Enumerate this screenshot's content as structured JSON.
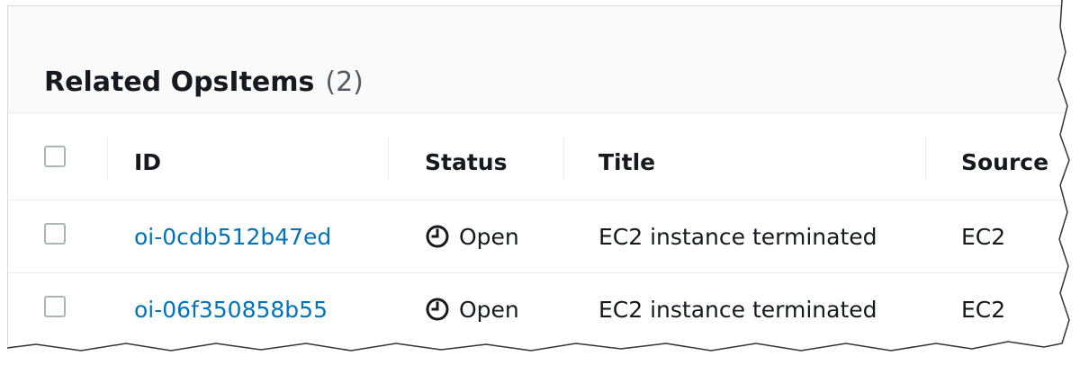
{
  "panel": {
    "title": "Related OpsItems",
    "count": "(2)"
  },
  "table": {
    "columns": [
      "ID",
      "Status",
      "Title",
      "Source"
    ],
    "rows": [
      {
        "id": "oi-0cdb512b47ed",
        "status": "Open",
        "title": "EC2 instance terminated",
        "source": "EC2"
      },
      {
        "id": "oi-06f350858b55",
        "status": "Open",
        "title": "EC2 instance terminated",
        "source": "EC2"
      }
    ]
  },
  "icons": {
    "status_open": "clock-icon"
  },
  "colors": {
    "link": "#0073bb",
    "header_bg": "#fafafa",
    "border": "#eaeded",
    "checkbox_border": "#aab7b8",
    "text": "#16191f"
  }
}
